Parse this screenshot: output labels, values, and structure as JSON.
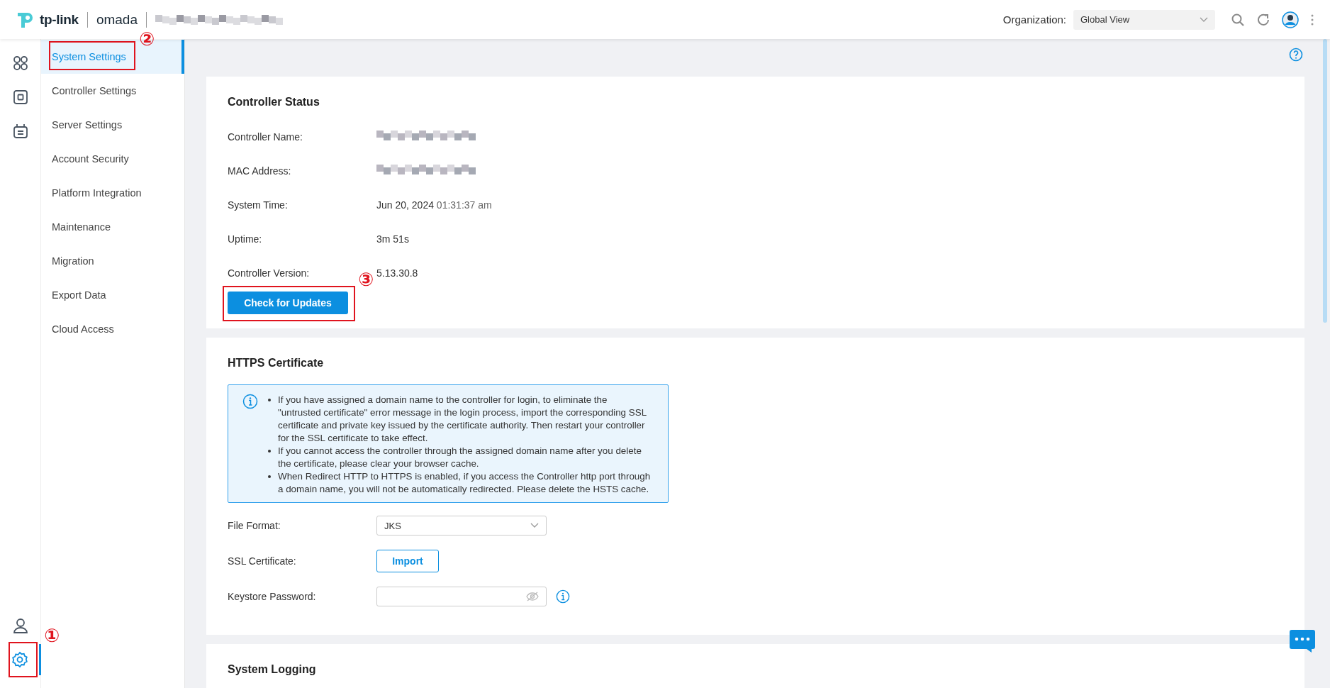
{
  "header": {
    "logo_text": "tp-link",
    "product": "omada",
    "organization_label": "Organization:",
    "organization": "Global View"
  },
  "rail": [
    {
      "kind": "grid",
      "selected": false
    },
    {
      "kind": "device",
      "selected": false
    },
    {
      "kind": "calendar",
      "selected": false
    }
  ],
  "rail_bottom": [
    {
      "kind": "user",
      "selected": false
    },
    {
      "kind": "gear",
      "selected": true
    }
  ],
  "subnav": [
    {
      "label": "System Settings",
      "selected": true
    },
    {
      "label": "Controller Settings",
      "selected": false
    },
    {
      "label": "Server Settings",
      "selected": false
    },
    {
      "label": "Account Security",
      "selected": false
    },
    {
      "label": "Platform Integration",
      "selected": false
    },
    {
      "label": "Maintenance",
      "selected": false
    },
    {
      "label": "Migration",
      "selected": false
    },
    {
      "label": "Export Data",
      "selected": false
    },
    {
      "label": "Cloud Access",
      "selected": false
    }
  ],
  "controller_status": {
    "title": "Controller Status",
    "rows": [
      {
        "label": "Controller Name:",
        "kind": "blurred"
      },
      {
        "label": "MAC Address:",
        "kind": "blurred"
      },
      {
        "label": "System Time:",
        "kind": "text",
        "value": "Jun 20, 2024",
        "value_secondary": "01:31:37 am"
      },
      {
        "label": "Uptime:",
        "kind": "text",
        "value": "3m 51s"
      },
      {
        "label": "Controller Version:",
        "kind": "text",
        "value": "5.13.30.8"
      }
    ],
    "button": "Check for Updates"
  },
  "https_certificate": {
    "title": "HTTPS Certificate",
    "notes": [
      "If you have assigned a domain name to the controller for login, to eliminate the \"untrusted certificate\" error message in the login process, import the corresponding SSL certificate and private key issued by the certificate authority. Then restart your controller for the SSL certificate to take effect.",
      "If you cannot access the controller through the assigned domain name after you delete the certificate, please clear your browser cache.",
      "When Redirect HTTP to HTTPS is enabled, if you access the Controller http port through a domain name, you will not be automatically redirected. Please delete the HSTS cache."
    ],
    "fields": [
      {
        "kind": "select",
        "label": "File Format:",
        "value": "JKS"
      },
      {
        "kind": "button",
        "label": "SSL Certificate:",
        "value": "Import"
      },
      {
        "kind": "password",
        "label": "Keystore Password:"
      }
    ]
  },
  "system_logging": {
    "title": "System Logging"
  },
  "annotations": [
    "①",
    "②",
    "③"
  ]
}
